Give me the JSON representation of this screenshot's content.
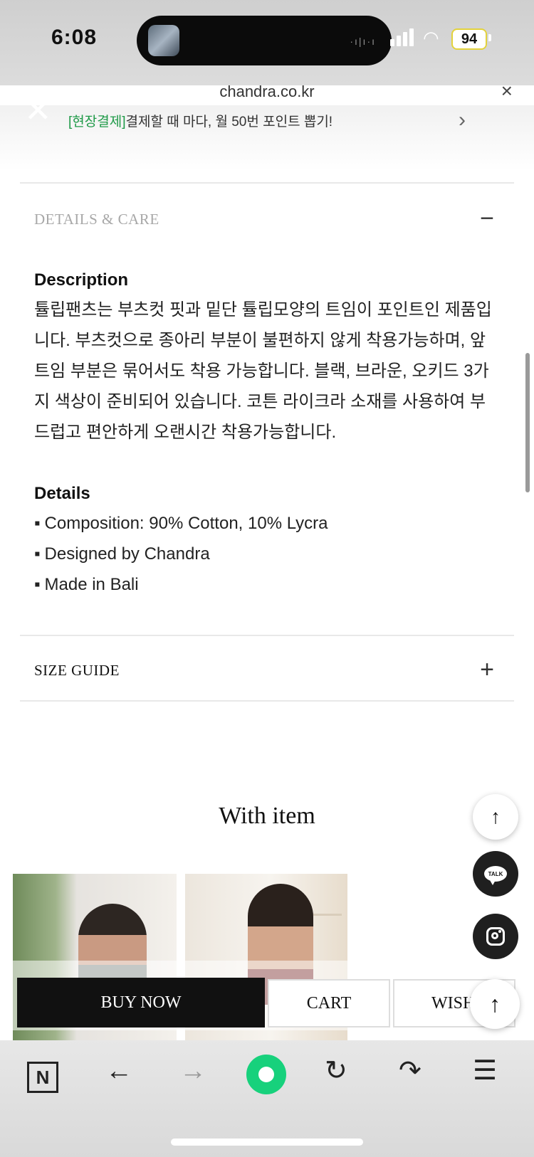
{
  "status_bar": {
    "time": "6:08",
    "battery": "94",
    "wave": "·ı|ı·ı"
  },
  "browser": {
    "url": "chandra.co.kr",
    "close_glyph": "×",
    "page_close_glyph": "✕"
  },
  "banner": {
    "highlight": "[현장결제]",
    "text": "결제할 때 마다, 월 50번 포인트 뽑기!",
    "chevron": "›"
  },
  "details_care": {
    "title": "DETAILS & CARE",
    "toggle": "−",
    "description_heading": "Description",
    "description": "튤립팬츠는 부츠컷 핏과 밑단 튤립모양의 트임이 포인트인 제품입니다. 부츠컷으로 종아리 부분이 불편하지 않게 착용가능하며, 앞트임 부분은 묶어서도 착용 가능합니다. 블랙, 브라운, 오키드 3가지 색상이 준비되어 있습니다. 코튼 라이크라 소재를 사용하여 부드럽고 편안하게 오랜시간 착용가능합니다.",
    "details_heading": "Details",
    "details": [
      "Composition: 90% Cotton, 10% Lycra",
      "Designed by Chandra",
      "Made in Bali"
    ]
  },
  "size_guide": {
    "title": "SIZE GUIDE",
    "toggle": "+"
  },
  "with_item": {
    "title": "With item"
  },
  "floating": {
    "up": "↑",
    "talk": "TALK"
  },
  "purchase_bar": {
    "buy_now": "BUY NOW",
    "cart": "CART",
    "wish": "WISH"
  },
  "toolbar": {
    "naver": "N",
    "back": "←",
    "forward": "→",
    "refresh": "↻",
    "share": "↷",
    "menu": "☰"
  },
  "colors": {
    "highlight_green": "#1f9a48",
    "buy_bg": "#111111",
    "home_green": "#17d17c"
  },
  "icons": [
    "close-icon",
    "chevron-right-icon",
    "minus-icon",
    "plus-icon",
    "arrow-up-icon",
    "kakao-talk-icon",
    "instagram-icon",
    "naver-icon",
    "back-arrow-icon",
    "forward-arrow-icon",
    "home-icon",
    "refresh-icon",
    "share-icon",
    "menu-icon"
  ]
}
